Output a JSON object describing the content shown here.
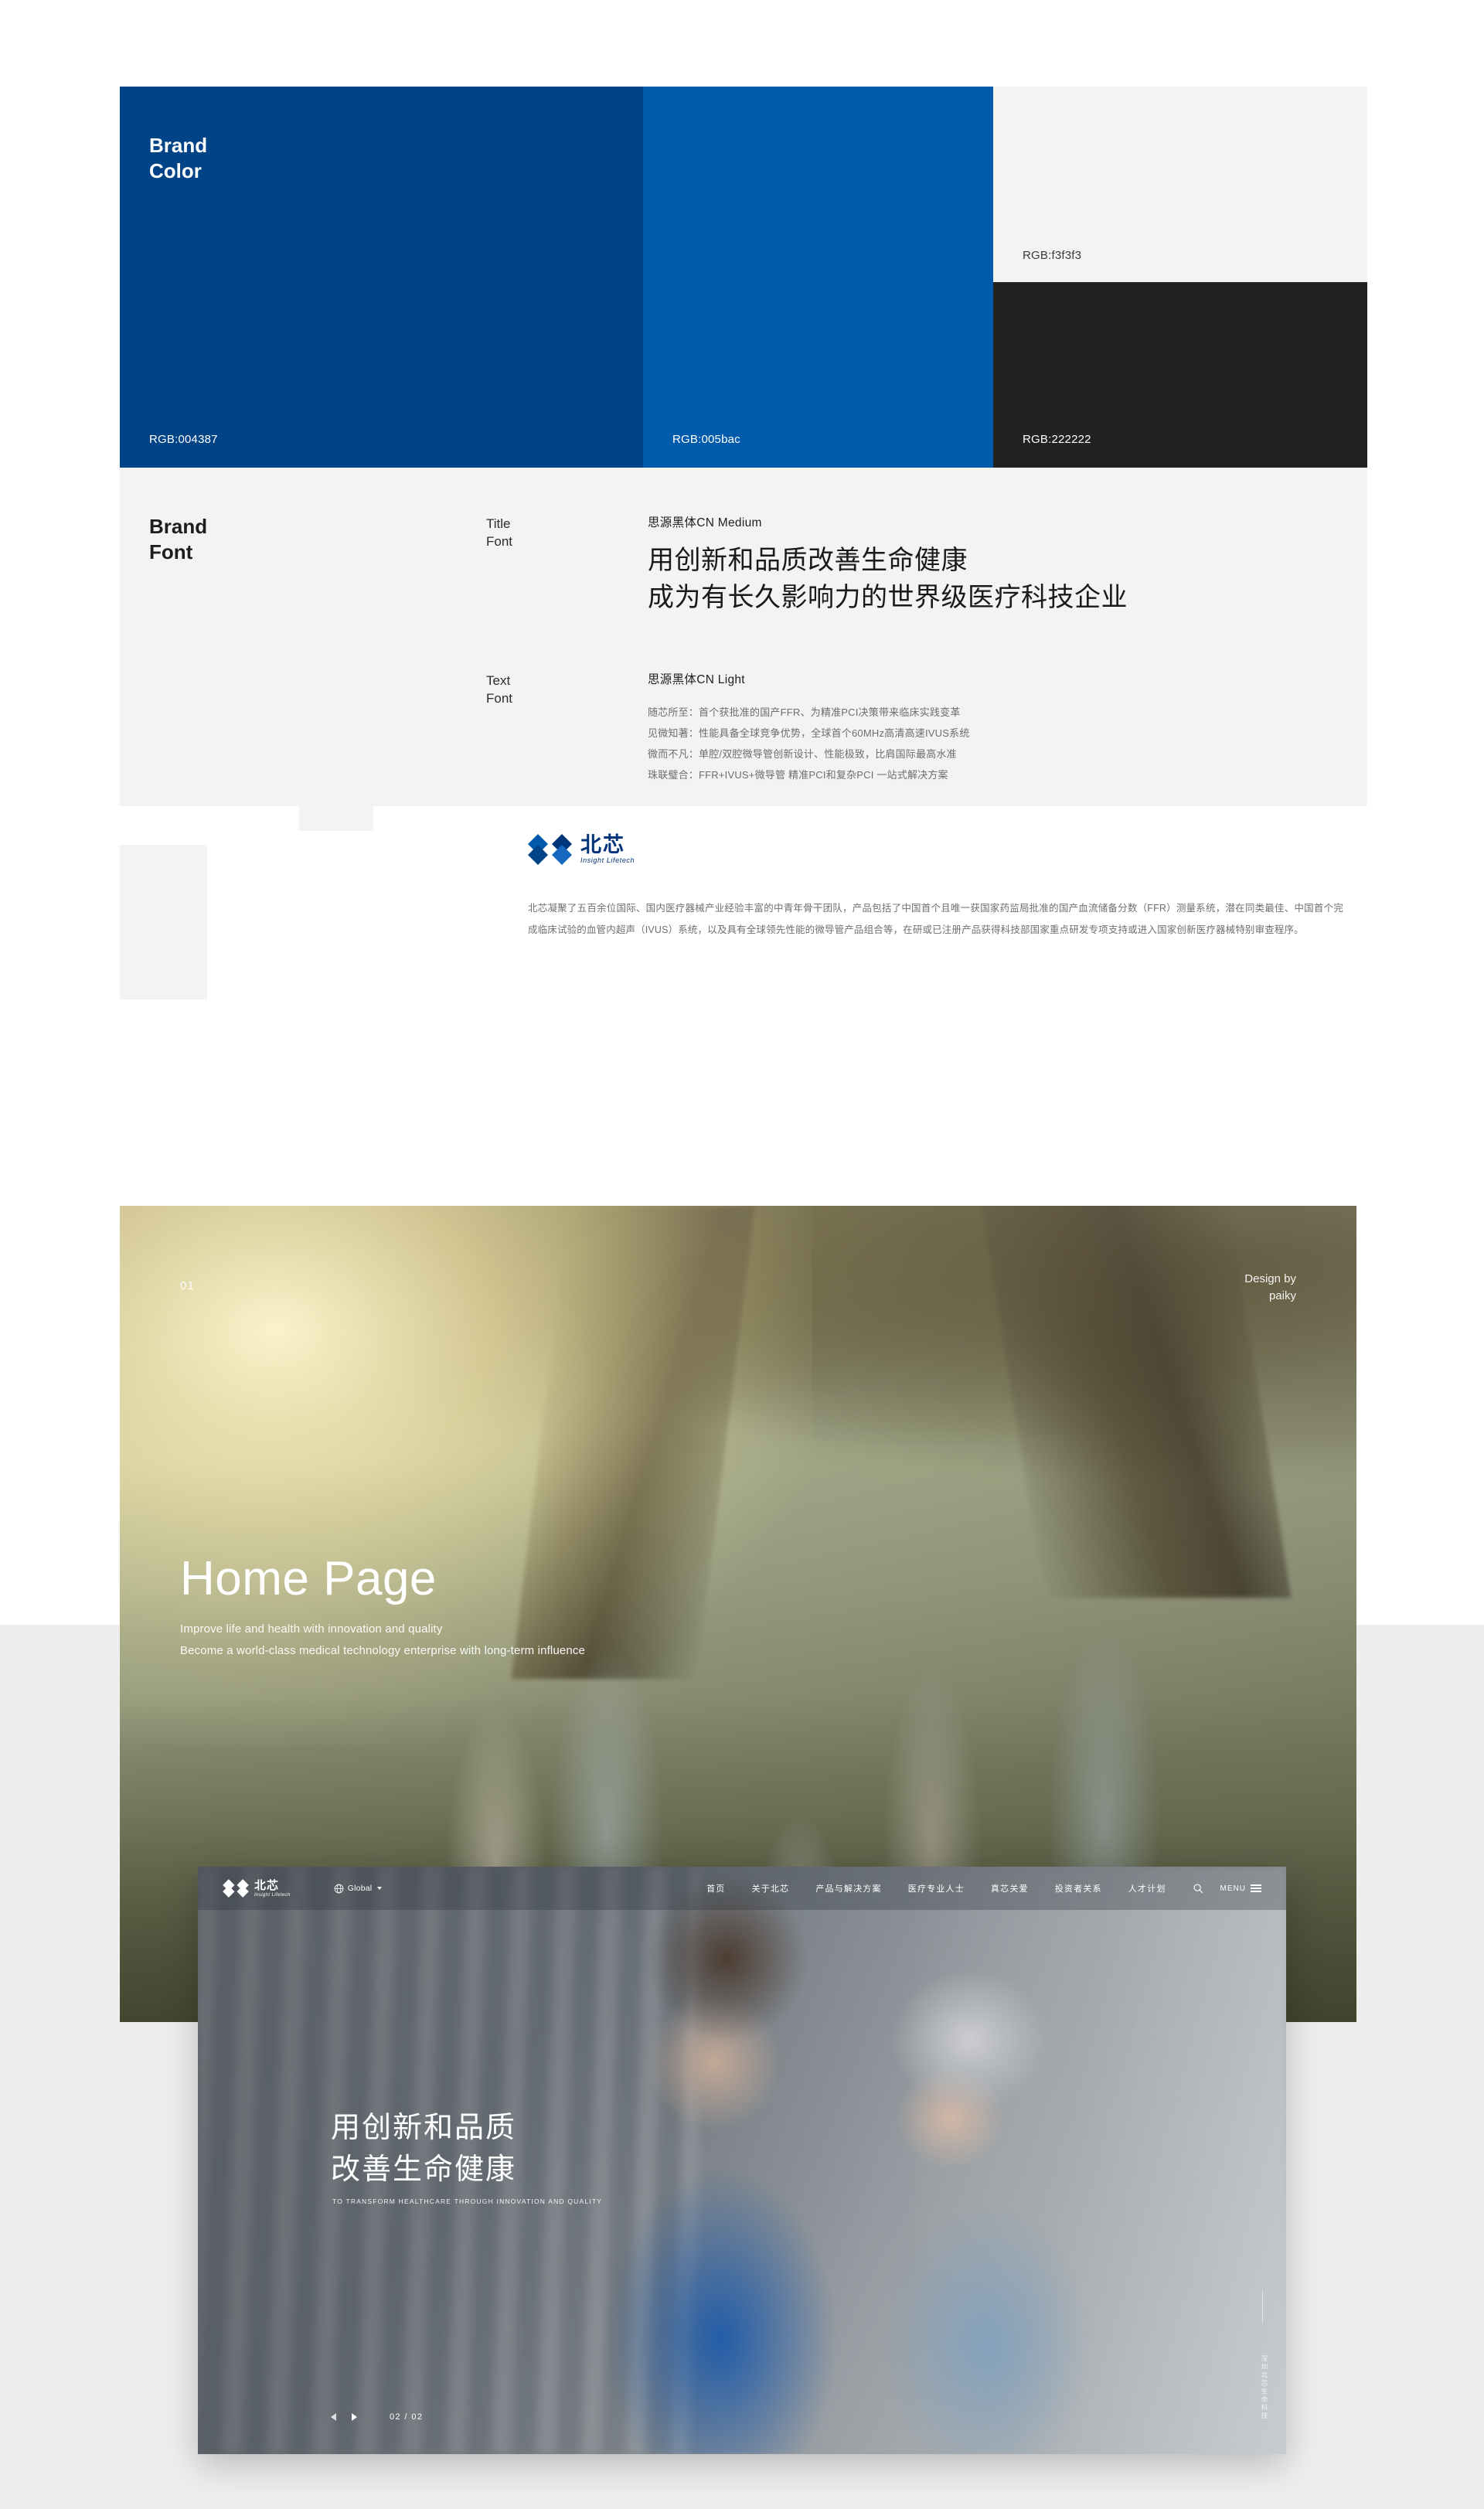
{
  "brand_color": {
    "title": "Brand\nColor",
    "title_line1": "Brand",
    "title_line2": "Color",
    "swatches": [
      {
        "name": "primary-dark-blue",
        "label": "RGB:004387",
        "hex": "#004387"
      },
      {
        "name": "primary-blue",
        "label": "RGB:005bac",
        "hex": "#005bac"
      },
      {
        "name": "neutral-light",
        "label": "RGB:f3f3f3",
        "hex": "#f3f3f3"
      },
      {
        "name": "neutral-dark",
        "label": "RGB:222222",
        "hex": "#222222"
      }
    ]
  },
  "brand_font": {
    "title_line1": "Brand",
    "title_line2": "Font",
    "title_font": {
      "label_line1": "Title",
      "label_line2": "Font",
      "family": "思源黑体CN  Medium",
      "sample_line1": "用创新和品质改善生命健康",
      "sample_line2": "成为有长久影响力的世界级医疗科技企业"
    },
    "text_font": {
      "label_line1": "Text",
      "label_line2": "Font",
      "family": "思源黑体CN  Light",
      "samples": [
        "随芯所至：首个获批准的国产FFR、为精准PCI决策带来临床实践变革",
        "见微知著：性能具备全球竞争优势，全球首个60MHz高清高速IVUS系统",
        "微而不凡：单腔/双腔微导管创新设计、性能极致，比肩国际最高水准",
        "珠联璧合：FFR+IVUS+微导管 精准PCI和复杂PCI 一站式解决方案"
      ]
    }
  },
  "company": {
    "logo_cn": "北芯",
    "logo_en": "Insight Lifetech",
    "description": "北芯凝聚了五百余位国际、国内医疗器械产业经验丰富的中青年骨干团队，产品包括了中国首个且唯一获国家药监局批准的国产血流储备分数（FFR）测量系统，潜在同类最佳、中国首个完成临床试验的血管内超声（IVUS）系统，以及具有全球领先性能的微导管产品组合等，在研或已注册产品获得科技部国家重点研发专项支持或进入国家创新医疗器械特别审查程序。"
  },
  "hero": {
    "number": "01",
    "credit_line1": "Design by",
    "credit_line2": "paiky",
    "title": "Home Page",
    "subtitle_line1": "Improve life and health with innovation and quality",
    "subtitle_line2": "Become a world-class medical technology enterprise with long-term influence"
  },
  "mockup": {
    "logo_cn": "北芯",
    "logo_en": "Insight Lifetech",
    "language_selector": "Global",
    "nav_items": [
      "首页",
      "关于北芯",
      "产品与解决方案",
      "医疗专业人士",
      "真芯关爱",
      "投资者关系",
      "人才计划"
    ],
    "menu_label": "MENU",
    "hero_title_line1": "用创新和品质",
    "hero_title_line2": "改善生命健康",
    "hero_tagline": "TO TRANSFORM HEALTHCARE THROUGH INNOVATION AND QUALITY",
    "slide_counter": "02 / 02",
    "side_text": "深圳北芯生命科技"
  }
}
